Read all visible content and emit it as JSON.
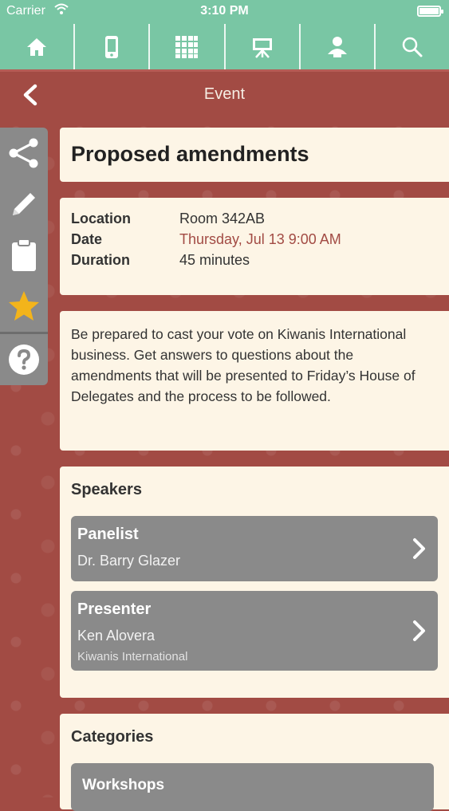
{
  "status_bar": {
    "carrier": "Carrier",
    "time": "3:10 PM"
  },
  "top_nav": {
    "items": [
      {
        "icon": "home-icon"
      },
      {
        "icon": "phone-icon"
      },
      {
        "icon": "grid-icon"
      },
      {
        "icon": "easel-icon"
      },
      {
        "icon": "person-icon"
      },
      {
        "icon": "search-icon"
      }
    ]
  },
  "header": {
    "title": "Event"
  },
  "sidebar": {
    "items": [
      {
        "icon": "share-icon"
      },
      {
        "icon": "pencil-icon"
      },
      {
        "icon": "clipboard-icon"
      },
      {
        "icon": "star-icon"
      },
      {
        "icon": "help-icon"
      }
    ]
  },
  "event": {
    "title": "Proposed amendments",
    "location_label": "Location",
    "location": "Room 342AB",
    "date_label": "Date",
    "date": "Thursday, Jul 13 9:00 AM",
    "duration_label": "Duration",
    "duration": "45 minutes",
    "description": "Be prepared to cast your vote on Kiwanis International business. Get answers to questions about the amendments that will be presented to Friday’s House of Delegates and the process to be followed."
  },
  "speakers": {
    "title": "Speakers",
    "items": [
      {
        "role": "Panelist",
        "name": "Dr. Barry Glazer",
        "org": ""
      },
      {
        "role": "Presenter",
        "name": "Ken Alovera",
        "org": "Kiwanis International"
      }
    ]
  },
  "categories": {
    "title": "Categories",
    "items": [
      {
        "label": "Workshops"
      }
    ]
  },
  "colors": {
    "nav_green": "#79c6a4",
    "header_red": "#a24b44",
    "card_bg": "#fdf5e6",
    "accent_red": "#a24b44",
    "sidebar_gray": "#8a8a8a",
    "star_yellow": "#f3b41b"
  }
}
